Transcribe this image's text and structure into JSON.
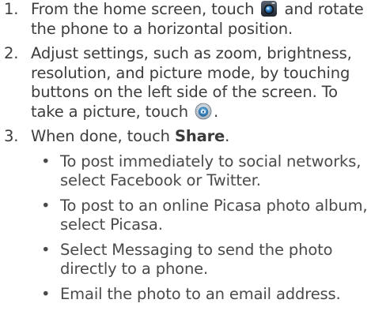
{
  "steps": [
    {
      "number": "1.",
      "text_before": "From the home screen, touch",
      "icon": "camera-app-icon",
      "text_after": "and rotate the phone to a horizontal position."
    },
    {
      "number": "2.",
      "text_before": "Adjust settings, such as zoom, brightness, resolution, and picture mode, by touching buttons on the left side of the screen. To take a picture, touch",
      "icon": "shutter-button-icon",
      "text_after": "."
    },
    {
      "number": "3.",
      "text_before": "When done, touch",
      "bold": "Share",
      "text_after": ".",
      "bullets": [
        {
          "marker": "•",
          "text": "To post immediately to social networks, select Facebook or Twitter."
        },
        {
          "marker": "•",
          "text": "To post to an online Picasa photo album, select Picasa."
        },
        {
          "marker": "•",
          "text": "Select Messaging to send the photo directly to a phone."
        },
        {
          "marker": "•",
          "text": "Email the photo to an email address."
        }
      ]
    }
  ],
  "colors": {
    "text": "#3d3d3d",
    "icon_dark": "#2b3440",
    "icon_blue": "#3a8fd0"
  }
}
